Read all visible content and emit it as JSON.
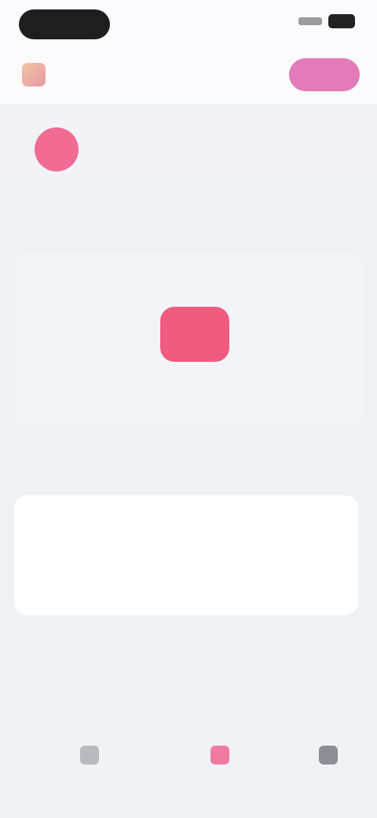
{
  "status_bar": {
    "pill_label": "",
    "signal_icon": "signal-icon",
    "battery_icon": "battery-icon"
  },
  "header": {
    "logo_icon": "app-logo-icon",
    "title": "",
    "action_label": ""
  },
  "profile": {
    "avatar_icon": "avatar-icon",
    "name": ""
  },
  "section": {
    "title": ""
  },
  "empty_state": {
    "icon": "empty-state-icon",
    "text": ""
  },
  "subsection": {
    "title": ""
  },
  "list": {
    "items": [
      {
        "label": ""
      },
      {
        "label": ""
      }
    ]
  },
  "link": {
    "label": ""
  },
  "bottom_nav": {
    "items": [
      {
        "icon": "home-icon",
        "label": ""
      },
      {
        "icon": "center-icon",
        "label": ""
      },
      {
        "icon": "profile-icon",
        "label": ""
      }
    ]
  },
  "colors": {
    "accent_pink": "#f05b7f",
    "header_pink": "#e37bb9",
    "background": "#f1f2f6"
  }
}
